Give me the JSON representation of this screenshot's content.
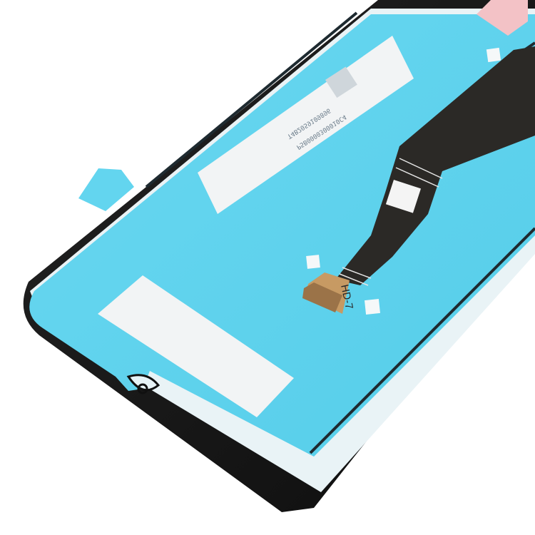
{
  "photo": {
    "subject": "LCD screen and digitizer assembly, back side",
    "colors": {
      "background": "#ffffff",
      "protective_film": "#5fd3ee",
      "bezel": "#141414",
      "flex_cable": "#2b2926",
      "connector": "#c79a63",
      "sticker": "#f2f4f5",
      "corner_sticker": "#f3c2c6"
    }
  },
  "labels": {
    "serial_line_1": "P5B0000300010C4",
    "serial_line_2": "T4B2059109896",
    "flex_marking": "HD-7"
  }
}
